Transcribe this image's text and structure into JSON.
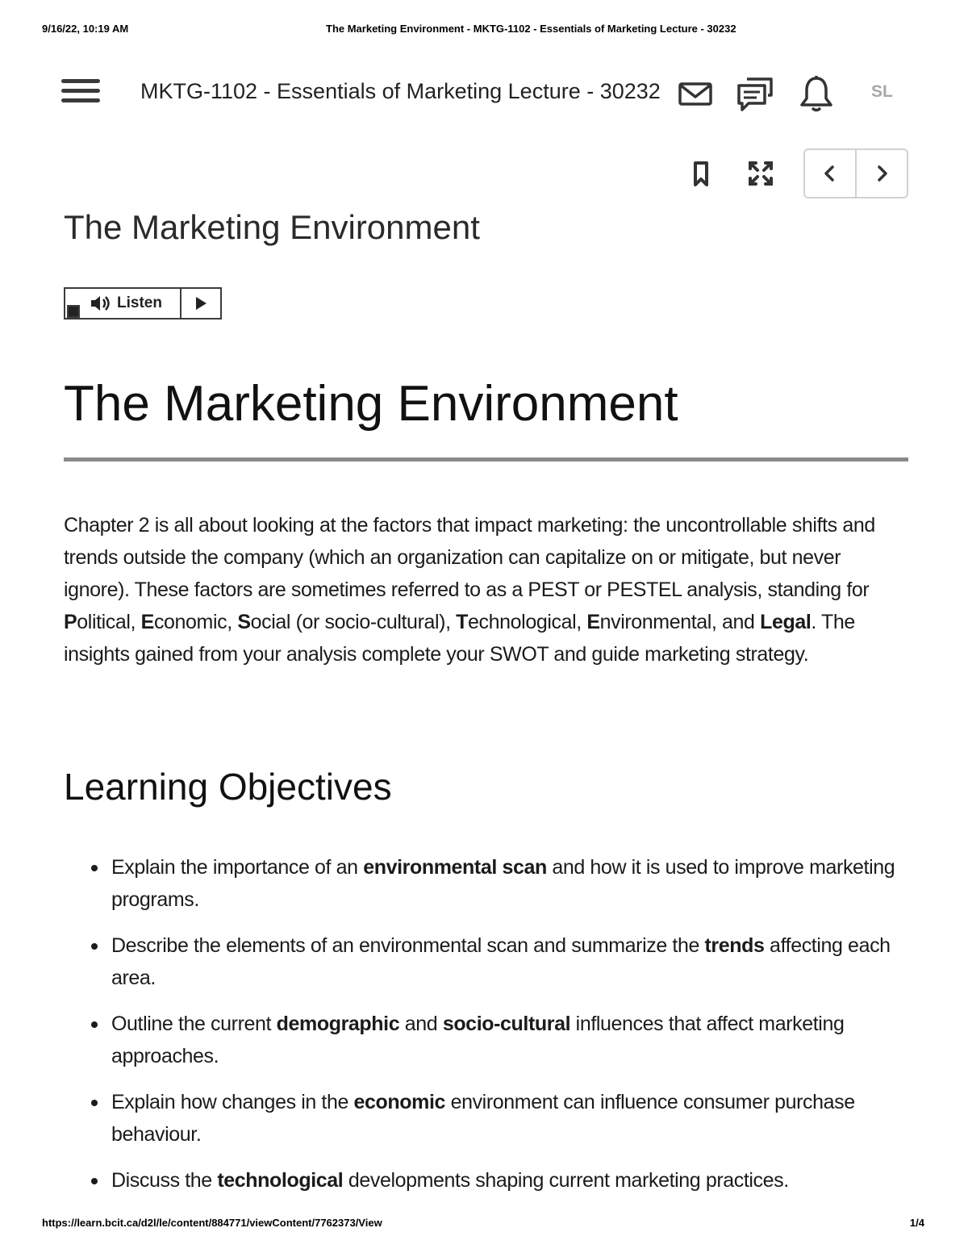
{
  "print_header": {
    "datetime": "9/16/22, 10:19 AM",
    "page_title": "The Marketing Environment - MKTG-1102 - Essentials of Marketing Lecture - 30232"
  },
  "navbar": {
    "course_title": "MKTG-1102 - Essentials of Marketing Lecture - 30232",
    "user_initials": "SL",
    "icons": [
      "menu-icon",
      "mail-icon",
      "chat-icon",
      "bell-icon"
    ]
  },
  "toolbar": {
    "icons": [
      "bookmark-icon",
      "fullscreen-icon",
      "chevron-left-icon",
      "chevron-right-icon"
    ]
  },
  "content": {
    "topic_title": "The Marketing Environment",
    "listen": {
      "label": "Listen"
    },
    "heading": "The Marketing Environment",
    "intro": {
      "p1": "Chapter 2 is all about looking at the factors that impact marketing: the uncontrollable shifts and trends outside the company (which an organization can capitalize on or mitigate, but never ignore). These factors are sometimes referred to as a PEST or PESTEL analysis, standing for ",
      "b_p": "P",
      "p2": "olitical, ",
      "b_e": "E",
      "p3": "conomic, ",
      "b_s": "S",
      "p4": "ocial (or socio-cultural), ",
      "b_t": "T",
      "p5": "echnological, ",
      "b_e2": "E",
      "p6": "nvironmental, and ",
      "b_legal": "Legal",
      "p7": ". The insights gained from your analysis complete your SWOT and guide marketing strategy."
    },
    "objectives_heading": "Learning Objectives",
    "objectives": [
      {
        "before": "Explain the importance of an ",
        "bold": "environmental scan",
        "after": " and how it is used to improve marketing programs."
      },
      {
        "before": "Describe the elements of an environmental scan and summarize the ",
        "bold": "trends",
        "after": " affecting each area."
      },
      {
        "before": "Outline the current ",
        "bold": "demographic",
        "middle": " and ",
        "bold2": "socio-cultural",
        "after": " influences that affect marketing approaches."
      },
      {
        "before": "Explain how changes in the ",
        "bold": "economic",
        "after": " environment can influence consumer purchase behaviour."
      },
      {
        "before": "Discuss the ",
        "bold": "technological",
        "after": " developments shaping current marketing practices."
      }
    ]
  },
  "print_footer": {
    "url": "https://learn.bcit.ca/d2l/le/content/884771/viewContent/7762373/View",
    "page": "1/4"
  }
}
